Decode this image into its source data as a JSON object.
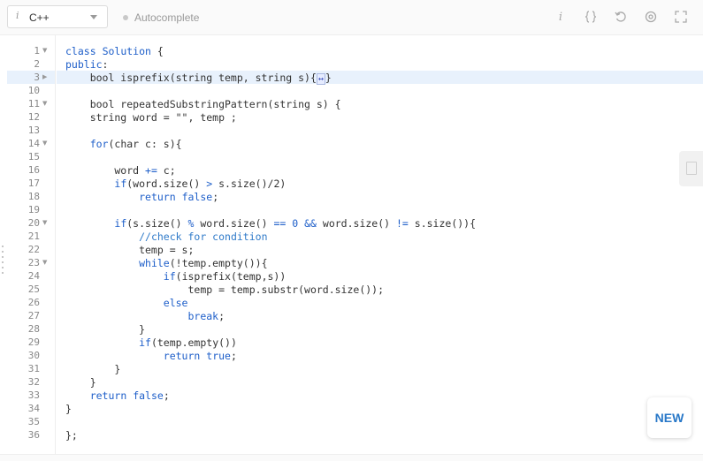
{
  "toolbar": {
    "language_info_glyph": "i",
    "language": "C++",
    "autocomplete_label": "Autocomplete",
    "icons": [
      "info-icon",
      "braces-icon",
      "reset-icon",
      "settings-icon",
      "fullscreen-icon"
    ]
  },
  "editor": {
    "line_numbers": [
      "1",
      "2",
      "3",
      "10",
      "11",
      "12",
      "13",
      "14",
      "15",
      "16",
      "17",
      "18",
      "19",
      "20",
      "21",
      "22",
      "23",
      "24",
      "25",
      "26",
      "27",
      "28",
      "29",
      "30",
      "31",
      "32",
      "33",
      "34",
      "35",
      "36"
    ],
    "folded_line": "3"
  },
  "buttons": {
    "new_label": "NEW"
  },
  "colors": {
    "keyword": "#1d5ec9",
    "highlight_line": "#e8f1fc",
    "accent": "#2878c8"
  }
}
